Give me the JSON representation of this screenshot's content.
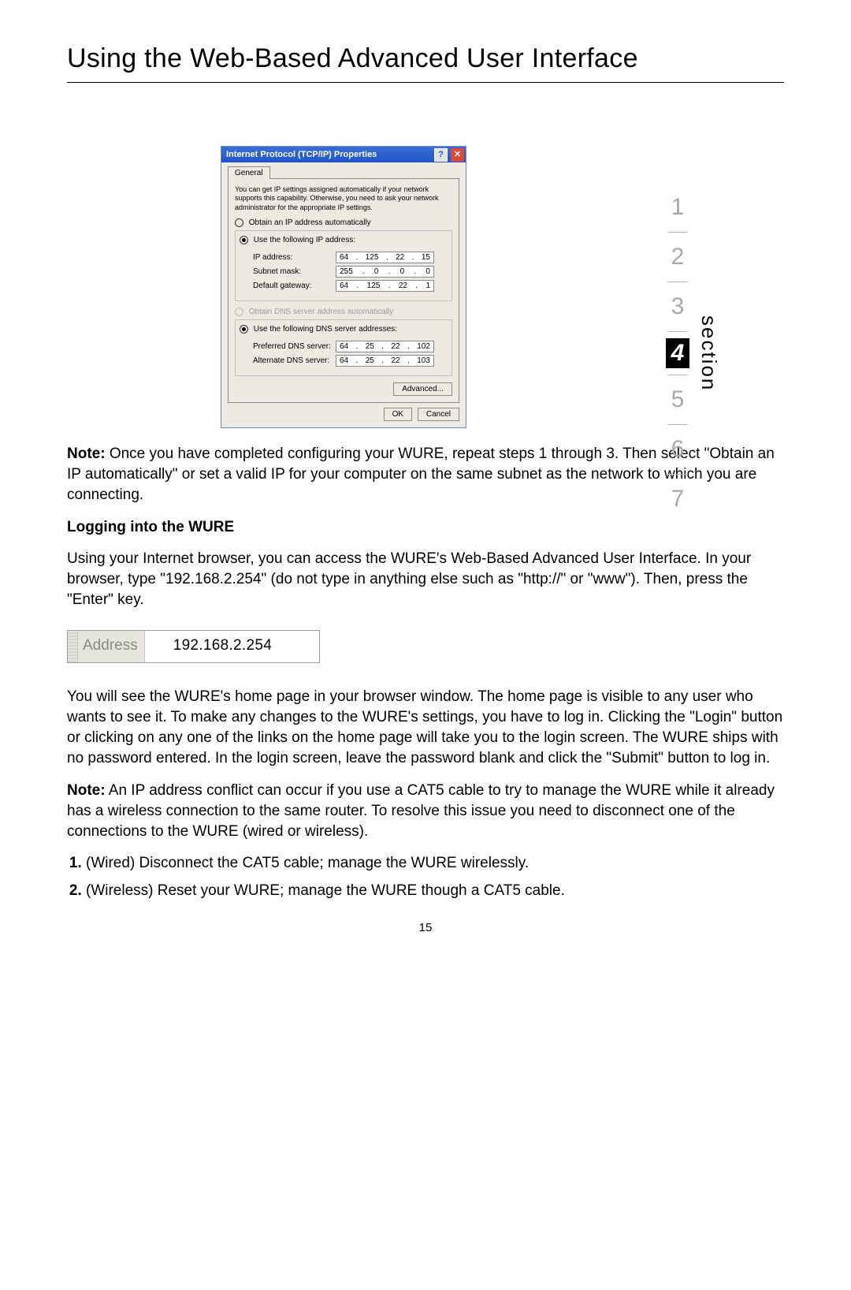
{
  "title": "Using the Web-Based Advanced User Interface",
  "sectionLabel": "section",
  "nav": {
    "items": [
      "1",
      "2",
      "3",
      "4",
      "5",
      "6",
      "7"
    ],
    "active": "4"
  },
  "dialog": {
    "title": "Internet Protocol (TCP/IP) Properties",
    "help": "?",
    "close": "✕",
    "tab": "General",
    "intro": "You can get IP settings assigned automatically if your network supports this capability. Otherwise, you need to ask your network administrator for the appropriate IP settings.",
    "radioAutoIp": "Obtain an IP address automatically",
    "radioUseIp": "Use the following IP address:",
    "ipLabel": "IP address:",
    "ip": [
      "64",
      "125",
      "22",
      "15"
    ],
    "maskLabel": "Subnet mask:",
    "mask": [
      "255",
      "0",
      "0",
      "0"
    ],
    "gwLabel": "Default gateway:",
    "gw": [
      "64",
      "125",
      "22",
      "1"
    ],
    "radioAutoDns": "Obtain DNS server address automatically",
    "radioUseDns": "Use the following DNS server addresses:",
    "prefDnsLabel": "Preferred DNS server:",
    "prefDns": [
      "64",
      "25",
      "22",
      "102"
    ],
    "altDnsLabel": "Alternate DNS server:",
    "altDns": [
      "64",
      "25",
      "22",
      "103"
    ],
    "advanced": "Advanced...",
    "ok": "OK",
    "cancel": "Cancel"
  },
  "note1Label": "Note:",
  "note1Body": " Once you have completed configuring your WURE, repeat steps 1 through 3. Then select \"Obtain an IP automatically\" or set a valid IP for your computer on the same subnet as the network to which you are connecting.",
  "subhead": "Logging into the WURE",
  "para1": "Using your Internet browser, you can access the WURE's Web-Based Advanced User Interface. In your browser, type \"192.168.2.254\" (do not type in anything else such as \"http://\" or \"www\"). Then, press the \"Enter\" key.",
  "addressLabel": "Address",
  "addressValue": "192.168.2.254",
  "para2": "You will see the WURE's home page in your browser window. The home page is visible to any user who wants to see it. To make any changes to the WURE's settings, you have to log in. Clicking the \"Login\" button or clicking on any one of the links on the home page will take you to the login screen. The WURE ships with no password entered. In the login screen, leave the password blank and click the \"Submit\" button to log in.",
  "note2Label": "Note:",
  "note2Body": " An IP address conflict can occur if you use a CAT5 cable to try to manage the WURE while it already has a wireless connection to the same router. To resolve this issue you need to disconnect one of the connections to the WURE (wired or wireless).",
  "step1": "(Wired) Disconnect the CAT5 cable; manage the WURE wirelessly.",
  "step2": "(Wireless) Reset your WURE; manage the WURE though a CAT5 cable.",
  "pageNumber": "15"
}
